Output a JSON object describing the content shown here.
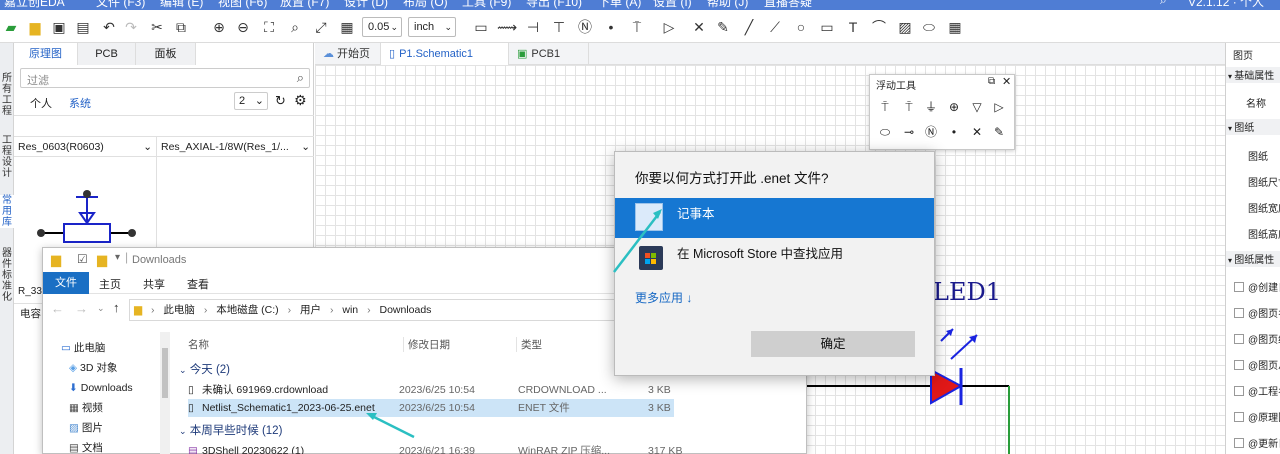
{
  "app": {
    "title_fragments": [
      "嘉立创EDA",
      "文件 (F3)",
      "编辑 (E)",
      "视图 (F6)",
      "放置 (F7)",
      "设计 (D)",
      "布局 (O)",
      "工具 (F9)",
      "导出 (F10)",
      "下单 (A)",
      "设置 (I)",
      "帮助 (J)",
      "直播答疑"
    ],
    "version": "V2.1.12 · 个人",
    "accent": "#4f7dd4"
  },
  "toolbar": {
    "grid_value": "0.05",
    "unit_value": "inch"
  },
  "left_strip": [
    "所有工程",
    "工程设计",
    "常用库",
    "器件标准化"
  ],
  "left_panel": {
    "tabs": [
      "原理图",
      "PCB",
      "面板"
    ],
    "search_placeholder": "过滤",
    "scope_tabs": [
      "个人",
      "系统"
    ],
    "page_select": "2",
    "parts": [
      "Res_0603(R0603)",
      "Res_AXIAL-1/8W(Res_1/..."
    ],
    "fragment_r": "R_33",
    "fragment_cap": "电容"
  },
  "doc_tabs": [
    "开始页",
    "P1.Schematic1",
    "PCB1"
  ],
  "canvas": {
    "component_label": "LED1"
  },
  "float_tools": {
    "title": "浮动工具"
  },
  "right_panel": {
    "header": "图页",
    "section1": "基础属性",
    "name_label": "名称",
    "section2": "图纸",
    "rows2": [
      "图纸",
      "图纸尺寸",
      "图纸宽度",
      "图纸高度"
    ],
    "section3": "图纸属性",
    "checks": [
      "@创建日期",
      "@图页名称",
      "@图页编号",
      "@图页总数",
      "@工程名称",
      "@原理图",
      "@更新日期"
    ]
  },
  "explorer": {
    "title": "Downloads",
    "ribbon": [
      "文件",
      "主页",
      "共享",
      "查看"
    ],
    "breadcrumb": [
      "此电脑",
      "本地磁盘 (C:)",
      "用户",
      "win",
      "Downloads"
    ],
    "nav": [
      "此电脑",
      "3D 对象",
      "Downloads",
      "视频",
      "图片",
      "文档"
    ],
    "columns": [
      "名称",
      "修改日期",
      "类型",
      "大小"
    ],
    "group_today": "今天 (2)",
    "group_week": "本周早些时候 (12)",
    "files": [
      {
        "name": "未确认 691969.crdownload",
        "date": "2023/6/25 10:54",
        "type": "CRDOWNLOAD ...",
        "size": "3 KB"
      },
      {
        "name": "Netlist_Schematic1_2023-06-25.enet",
        "date": "2023/6/25 10:54",
        "type": "ENET 文件",
        "size": "3 KB"
      },
      {
        "name": "3DShell 20230622 (1)",
        "date": "2023/6/21 16:39",
        "type": "WinRAR ZIP 压缩...",
        "size": "317 KB"
      }
    ]
  },
  "dialog": {
    "question": "你要以何方式打开此 .enet 文件?",
    "option1": "记事本",
    "option2": "在 Microsoft Store 中查找应用",
    "more_apps": "更多应用 ↓",
    "ok": "确定"
  }
}
